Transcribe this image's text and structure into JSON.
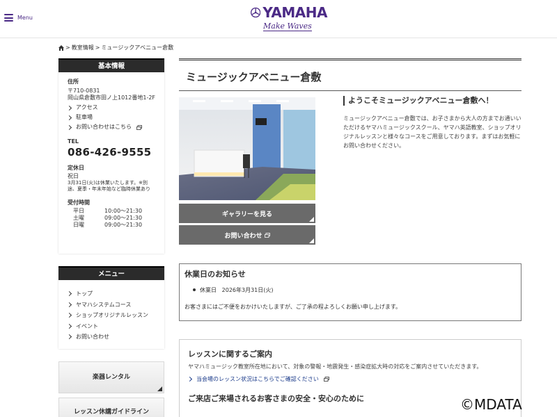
{
  "header": {
    "menu_label": "Menu",
    "logo_text": "YAMAHA",
    "logo_tagline": "Make Waves"
  },
  "breadcrumb": [
    "教室情報",
    "ミュージックアベニュー倉敷"
  ],
  "basic_info": {
    "heading": "基本情報",
    "address_label": "住所",
    "postal_code": "〒710-0831",
    "address": "岡山県倉敷市田ノ上1012番地1-2F",
    "links": [
      "アクセス",
      "駐車場",
      "お問い合わせはこちら"
    ],
    "tel_label": "TEL",
    "tel": "086-426-9555",
    "holiday_label": "定休日",
    "holiday": "祝日",
    "holiday_note": "3月31日(火)は休業いたします。※別途、夏季・年末年始など臨時休業あり",
    "hours_label": "受付時間",
    "hours": [
      {
        "day": "平日",
        "time": "10:00〜21:30"
      },
      {
        "day": "土曜",
        "time": "09:00〜21:30"
      },
      {
        "day": "日曜",
        "time": "09:00〜21:30"
      }
    ]
  },
  "menu_box": {
    "heading": "メニュー",
    "items": [
      "トップ",
      "ヤマハシステムコース",
      "ショップオリジナルレッスン",
      "イベント",
      "お問い合わせ"
    ]
  },
  "side_buttons": [
    "楽器レンタル",
    "レッスン休講ガイドライン"
  ],
  "main": {
    "title": "ミュージックアベニュー倉敷",
    "gallery_button": "ギャラリーを見る",
    "contact_button": "お問い合わせ",
    "welcome_heading": "ようこそミュージックアベニュー倉敷へ！",
    "welcome_text": "ミュージックアベニュー倉敷では、お子さまから大人の方までお通いいただけるヤマハミュージックスクール、ヤマハ英語教室、ショップオリジナルレッスンと様々なコースをご用意しております。まずはお気軽にお問い合わせください。",
    "notice": {
      "heading": "休業日のお知らせ",
      "row_label": "休業日",
      "row_date": "2026年3月31日(火)",
      "text": "お客さまにはご不便をおかけいたしますが、ご了承の程よろしくお願い申し上げます。"
    },
    "lesson": {
      "heading": "レッスンに関するご案内",
      "text": "ヤマハミュージック教室所在地において、対象の警報・地震発生・感染症拡大時の対応をご案内させていただきます。",
      "link": "当会場のレッスン状況はこちらでご確認ください",
      "heading2": "ご来店ご来場されるお客さまの安全・安心のために"
    }
  },
  "watermark": "©MDATA",
  "colors": {
    "brand": "#4b2a86",
    "dark_head": "#2b2b2b",
    "button_gray": "#6a6a6a"
  }
}
